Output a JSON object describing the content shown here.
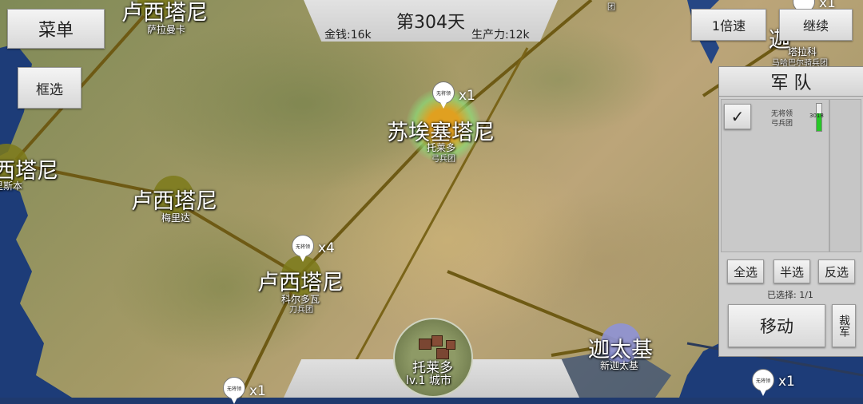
{
  "top_bar": {
    "day": "第304天",
    "money": "金钱:16k",
    "production": "生产力:12k"
  },
  "buttons": {
    "menu": "菜单",
    "box_select": "框选",
    "speed": "1倍速",
    "continue": "继续"
  },
  "army_panel": {
    "title": "军 队",
    "unit": {
      "commander": "无将领",
      "type": "弓兵团",
      "count": "3018"
    },
    "select_all": "全选",
    "select_half": "半选",
    "select_invert": "反选",
    "selected": "已选择: 1/1",
    "move": "移动",
    "disband": "裁军"
  },
  "city_bar": {
    "name": "托莱多",
    "level": "lv.1 城市"
  },
  "nodes": [
    {
      "faction": "卢西塔尼",
      "city": "萨拉曼卡"
    },
    {
      "faction": "西塔尼",
      "city": "里斯本"
    },
    {
      "faction": "卢西塔尼",
      "city": "梅里达"
    },
    {
      "faction": "苏埃塞塔尼",
      "city": "托莱多",
      "unit": "弓兵团"
    },
    {
      "faction": "卢西塔尼",
      "city": "科尔多瓦",
      "unit": "刀兵团"
    },
    {
      "faction": "迦太基",
      "city": "新迦太基"
    },
    {
      "faction": "迦",
      "city": "塔拉科",
      "unit": "马哈巴尔骑兵团"
    }
  ],
  "army_markers": [
    {
      "commander": "无将领",
      "count": "x1"
    },
    {
      "commander": "无将领",
      "count": "x4"
    },
    {
      "commander": "无将领",
      "count": "x1"
    },
    {
      "commander": "无将领",
      "count": "x1"
    },
    {
      "commander": "",
      "count": "x1"
    }
  ],
  "top_right_label": "团"
}
